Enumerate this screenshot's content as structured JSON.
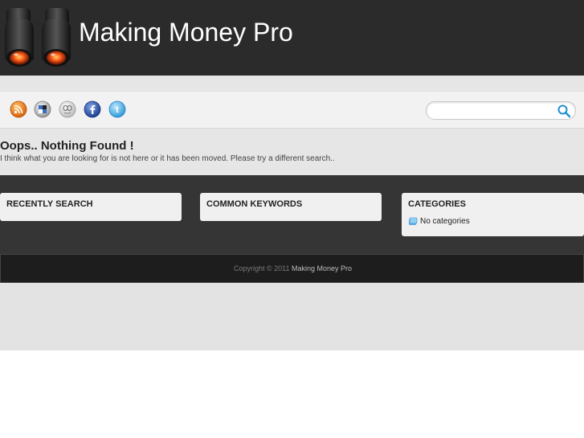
{
  "header": {
    "site_title": "Making Money Pro"
  },
  "toolbar": {
    "social_icons": [
      "rss-icon",
      "delicious-icon",
      "digg-icon",
      "facebook-icon",
      "twitter-icon"
    ],
    "search": {
      "value": "",
      "placeholder": ""
    }
  },
  "content": {
    "not_found_title": "Oops.. Nothing Found !",
    "not_found_text": "I think what you are looking for is not here or it has been moved. Please try a different search.."
  },
  "widgets": {
    "recently_search": {
      "title": "RECENTLY SEARCH"
    },
    "common_keywords": {
      "title": "COMMON KEYWORDS"
    },
    "categories": {
      "title": "CATEGORIES",
      "items": [
        "No categories"
      ]
    }
  },
  "footer": {
    "copyright_prefix": "Copyright © 2011",
    "site_name": "Making Money Pro"
  },
  "colors": {
    "header_bg": "#2b2b2b",
    "dark_area": "#353535",
    "footer_bg": "#1d1d1d",
    "search_accent": "#1e8fcf"
  }
}
